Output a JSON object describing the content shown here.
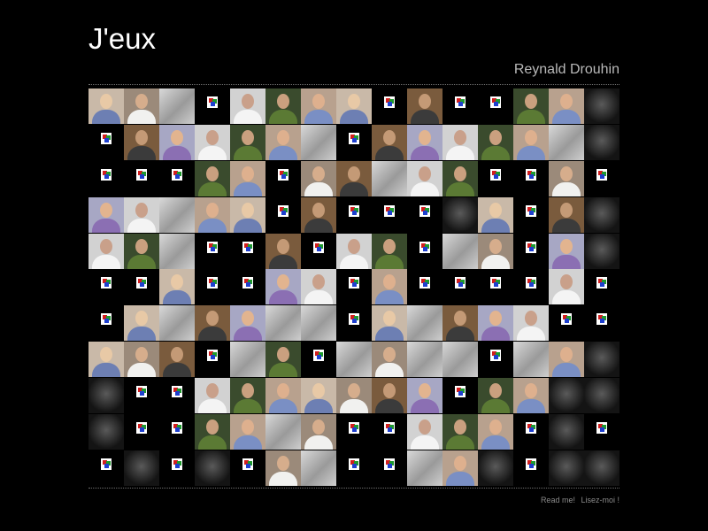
{
  "page": {
    "title": "J'eux",
    "author": "Reynald Drouhin",
    "links": [
      {
        "label": "Read me!"
      },
      {
        "label": "Lisez-moi !"
      }
    ]
  },
  "grid": {
    "columns": 15,
    "rows": 11,
    "tiles": [
      "P",
      "P",
      "G",
      "B",
      "P",
      "P",
      "P",
      "P",
      "B",
      "P",
      "B",
      "B",
      "P",
      "P",
      "D",
      "B",
      "P",
      "P",
      "P",
      "P",
      "P",
      "G",
      "B",
      "P",
      "P",
      "P",
      "P",
      "P",
      "G",
      "D",
      "B",
      "B",
      "B",
      "P",
      "P",
      "B",
      "P",
      "P",
      "G",
      "P",
      "P",
      "B",
      "B",
      "P",
      "B",
      "P",
      "P",
      "G",
      "P",
      "P",
      "B",
      "P",
      "B",
      "B",
      "B",
      "D",
      "P",
      "B",
      "P",
      "D",
      "P",
      "P",
      "G",
      "B",
      "B",
      "P",
      "B",
      "P",
      "P",
      "B",
      "G",
      "P",
      "B",
      "P",
      "D",
      "B",
      "B",
      "P",
      "B",
      "B",
      "P",
      "P",
      "B",
      "P",
      "B",
      "B",
      "B",
      "B",
      "P",
      "B",
      "B",
      "P",
      "G",
      "P",
      "P",
      "G",
      "G",
      "B",
      "P",
      "G",
      "P",
      "P",
      "P",
      "B",
      "B",
      "P",
      "P",
      "P",
      "B",
      "G",
      "P",
      "B",
      "G",
      "P",
      "G",
      "G",
      "B",
      "G",
      "P",
      "D",
      "D",
      "B",
      "B",
      "P",
      "P",
      "P",
      "P",
      "P",
      "P",
      "P",
      "B",
      "P",
      "P",
      "D",
      "D",
      "D",
      "B",
      "B",
      "P",
      "P",
      "G",
      "P",
      "B",
      "B",
      "P",
      "P",
      "P",
      "B",
      "D",
      "B",
      "B",
      "D",
      "B",
      "D",
      "B",
      "P",
      "G",
      "B",
      "B",
      "G",
      "P",
      "D",
      "B",
      "D",
      "D"
    ]
  },
  "colors": {
    "background": "#000000",
    "title": "#ffffff",
    "author": "#b9b9b9",
    "rule": "#6d6d6d",
    "links": "#8a8a8a",
    "badge_red": "#d21e1e",
    "badge_green": "#1e9a2e",
    "badge_blue": "#1e3fcf"
  },
  "icons": {
    "badge": "broken-image-icon"
  }
}
